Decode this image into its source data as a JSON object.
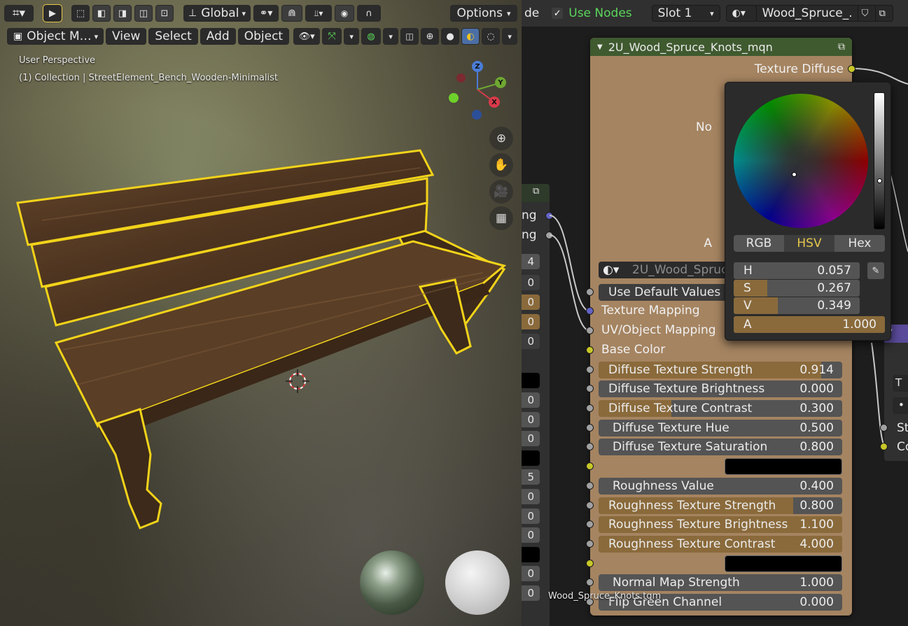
{
  "viewport": {
    "header": {
      "transform_orientation": "Global",
      "options_label": "Options"
    },
    "menu": {
      "mode_label": "Object M…",
      "view": "View",
      "select": "Select",
      "add": "Add",
      "object": "Object"
    },
    "overlay": {
      "perspective": "User Perspective",
      "collection": "(1) Collection | StreetElement_Bench_Wooden-Minimalist"
    },
    "gizmo": {
      "z": "Z",
      "y": "Y",
      "x": "X"
    },
    "environment_label": "Wood_Spruce_Knots.tqm"
  },
  "node_editor": {
    "header": {
      "partial_label": "de",
      "use_nodes_label": "Use Nodes",
      "slot_label": "Slot 1",
      "material_name": "Wood_Spruce_..."
    },
    "left_node": {
      "socket_labels": [
        "ng",
        "ng"
      ],
      "field_values": [
        "4",
        "0",
        "0",
        "0",
        "0",
        "0",
        "0",
        "0",
        "5",
        "0",
        "0",
        "0",
        "0",
        "0"
      ]
    },
    "main_node": {
      "title": "2U_Wood_Spruce_Knots_mqn",
      "output_label": "Texture Diffuse",
      "partial_outputs": [
        "No",
        "A"
      ],
      "group_name": "2U_Wood_Spruc",
      "rows": [
        {
          "name": "Use Default Values",
          "value": "",
          "fill": 0
        },
        {
          "name": "Texture Mapping",
          "socket": "blue",
          "value": ""
        },
        {
          "name": "UV/Object Mapping",
          "socket": "grey",
          "value": ""
        },
        {
          "name": "Base Color",
          "socket": "yellow",
          "value": ""
        },
        {
          "name": "Diffuse Texture Strength",
          "value": "0.914",
          "fill": 0.914
        },
        {
          "name": "Diffuse Texture Brightness",
          "value": "0.000",
          "fill": 0.0
        },
        {
          "name": "Diffuse Texture Contrast",
          "value": "0.300",
          "fill": 0.3
        },
        {
          "name": "Diffuse Texture Hue",
          "value": "0.500",
          "fill": 0.5
        },
        {
          "name": "Diffuse Texture Saturation",
          "value": "0.800",
          "fill": 0.8
        },
        {
          "name": "Roughness Value",
          "value": "0.400",
          "fill": 0.4
        },
        {
          "name": "Roughness Texture Strength",
          "value": "0.800",
          "fill": 0.8
        },
        {
          "name": "Roughness Texture Brightness",
          "value": "1.100",
          "fill": 1.1
        },
        {
          "name": "Roughness Texture Contrast",
          "value": "4.000",
          "fill": 4.0
        },
        {
          "name": "Normal Map Strength",
          "value": "1.000",
          "fill": 1.0
        },
        {
          "name": "Flip Green Channel",
          "value": "0.000",
          "fill": 0.0
        }
      ]
    },
    "right_node": {
      "partial_labels": [
        "T",
        "•",
        "St",
        "Co"
      ]
    },
    "color_picker": {
      "tabs": [
        "RGB",
        "HSV",
        "Hex"
      ],
      "active_tab": "HSV",
      "fields": [
        {
          "name": "H",
          "value": "0.057"
        },
        {
          "name": "S",
          "value": "0.267"
        },
        {
          "name": "V",
          "value": "0.349"
        },
        {
          "name": "A",
          "value": "1.000"
        }
      ]
    }
  },
  "colors": {
    "node_body": "#a58461",
    "node_header": "#3f5a2f",
    "slider_fill": "#8a6a3b",
    "selection_outline": "#f2d31a",
    "use_nodes_green": "#5bd65b"
  },
  "icons": {
    "select_tool": "arrow-cursor-icon",
    "zoom": "magnifier-icon",
    "pan": "hand-icon",
    "camera": "camera-icon",
    "grid": "grid-icon",
    "eyedropper": "eyedropper-icon"
  }
}
